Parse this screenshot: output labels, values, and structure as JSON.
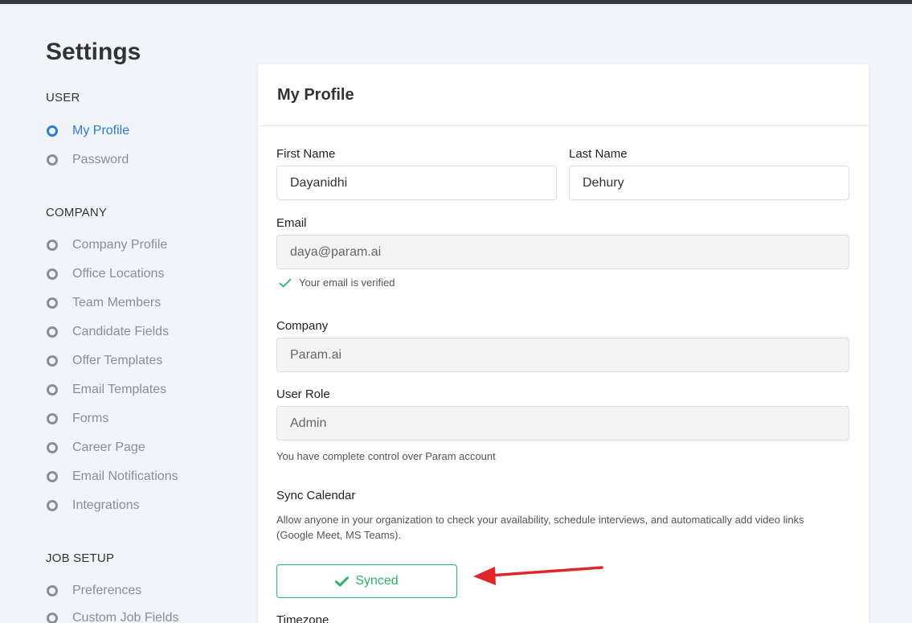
{
  "page": {
    "title": "Settings"
  },
  "sidebar": {
    "sections": [
      {
        "heading": "USER",
        "items": [
          {
            "label": "My Profile",
            "active": true
          },
          {
            "label": "Password"
          }
        ]
      },
      {
        "heading": "COMPANY",
        "items": [
          {
            "label": "Company Profile"
          },
          {
            "label": "Office Locations"
          },
          {
            "label": "Team Members"
          },
          {
            "label": "Candidate Fields"
          },
          {
            "label": "Offer Templates"
          },
          {
            "label": "Email Templates"
          },
          {
            "label": "Forms"
          },
          {
            "label": "Career Page"
          },
          {
            "label": "Email Notifications"
          },
          {
            "label": "Integrations"
          }
        ]
      },
      {
        "heading": "JOB SETUP",
        "items": [
          {
            "label": "Preferences"
          },
          {
            "label": "Custom Job Fields"
          }
        ]
      }
    ]
  },
  "profile": {
    "title": "My Profile",
    "first_name": {
      "label": "First Name",
      "value": "Dayanidhi"
    },
    "last_name": {
      "label": "Last Name",
      "value": "Dehury"
    },
    "email": {
      "label": "Email",
      "value": "daya@param.ai",
      "verified_text": "Your email is verified"
    },
    "company": {
      "label": "Company",
      "value": "Param.ai"
    },
    "role": {
      "label": "User Role",
      "value": "Admin",
      "helper": "You have complete control over Param account"
    },
    "sync": {
      "label": "Sync Calendar",
      "description": "Allow anyone in your organization to check your availability, schedule interviews, and automatically add video links (Google Meet, MS Teams).",
      "button_label": "Synced"
    },
    "timezone": {
      "label": "Timezone"
    }
  },
  "colors": {
    "accent": "#2b7ed3",
    "success": "#2bb36a",
    "annotation_arrow": "#e0262b",
    "topbar": "#323a46"
  }
}
